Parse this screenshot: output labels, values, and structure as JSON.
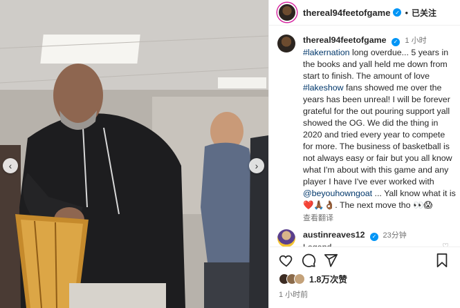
{
  "header": {
    "username": "thereal94feetofgame",
    "separator": "•",
    "follow_state": "已关注"
  },
  "caption": {
    "username": "thereal94feetofgame",
    "time": "1 小时",
    "hashtag1": "#lakernation",
    "text1": " long overdue... 5 years in the books and yall held me down from start to finish. The amount of love ",
    "hashtag2": "#lakeshow",
    "text2": " fans showed me over the years has been unreal! I will be forever grateful for the out pouring support yall showed the OG. We did the thing in 2020 and tried every year to compete for more. The business of basketball is not always easy or fair but you all know what I'm about with this game and any player I have I've ever worked with ",
    "mention": "@beyouhowngoat",
    "text3": " ... Yall know what it is ❤️🙏🏾👌🏾. The next move tho 👀😱",
    "translate": "查看翻译"
  },
  "comment": {
    "username": "austinreaves12",
    "time": "23分钟",
    "text": "Legend"
  },
  "actions": {
    "likes": "1.8万次赞",
    "post_time": "1 小时前"
  },
  "icons": {
    "verified": "verified-badge-icon",
    "like": "heart-icon",
    "comment": "comment-bubble-icon",
    "share": "paper-plane-icon",
    "save": "bookmark-icon",
    "prev": "chevron-left-icon",
    "next": "chevron-right-icon"
  },
  "colors": {
    "verified": "#0095f6",
    "link": "#00376b",
    "muted": "#737373"
  }
}
